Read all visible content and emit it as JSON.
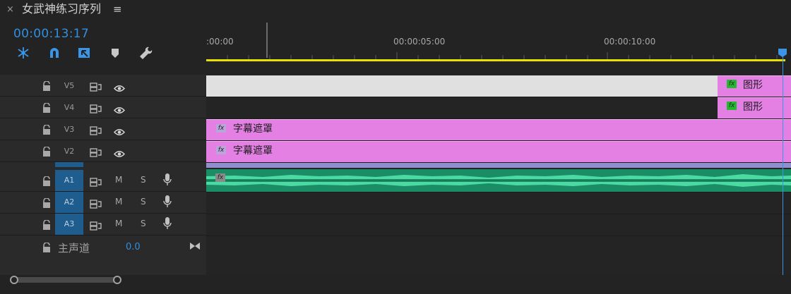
{
  "tab": {
    "close": "×",
    "title": "女武神练习序列",
    "menu": "≡"
  },
  "timecode": "00:00:13:17",
  "toolbar": {
    "tools": [
      "snap-insert-icon",
      "magnet-icon",
      "linked-selection-icon",
      "marker-icon",
      "wrench-icon"
    ],
    "accent": "#3a95e6"
  },
  "ruler": {
    "ticks": [
      ":00:00",
      "00:00:05:00",
      "00:00:10:00"
    ],
    "work_area_color": "#e8e000"
  },
  "video_tracks": [
    {
      "name": "V5"
    },
    {
      "name": "V4"
    },
    {
      "name": "V3"
    },
    {
      "name": "V2"
    }
  ],
  "audio_tracks": [
    {
      "name": "A1",
      "m": "M",
      "s": "S"
    },
    {
      "name": "A2",
      "m": "M",
      "s": "S"
    },
    {
      "name": "A3",
      "m": "M",
      "s": "S"
    }
  ],
  "master": {
    "label": "主声道",
    "value": "0.0"
  },
  "clips": {
    "v5_graphic": {
      "fx": "fx",
      "label": "图形"
    },
    "v4_graphic": {
      "fx": "fx",
      "label": "图形"
    },
    "v3_matte": {
      "fx": "fx",
      "label": "字幕遮罩"
    },
    "v2_matte": {
      "fx": "fx",
      "label": "字幕遮罩"
    },
    "a1_audio": {
      "fx": "fx"
    }
  },
  "colors": {
    "graphic_clip": "#e480e4",
    "audio_clip": "#1a8d66",
    "audio_track_label_bg": "#1f5d8f",
    "playhead": "#3a95e6"
  }
}
